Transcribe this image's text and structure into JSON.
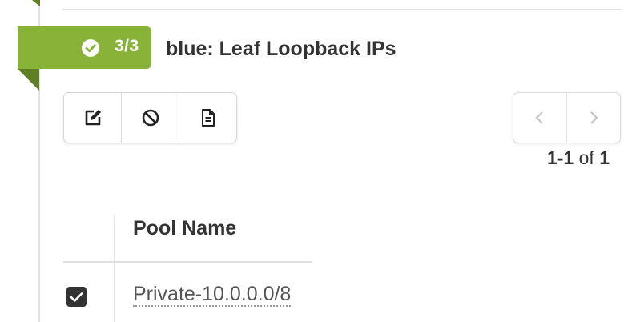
{
  "step": {
    "badge_count": "3/3",
    "title": "blue: Leaf Loopback IPs",
    "badge_color": "#88b338",
    "fold_color": "#5f7f24"
  },
  "toolbar": {
    "buttons": [
      {
        "icon": "edit-icon"
      },
      {
        "icon": "ban-icon"
      },
      {
        "icon": "document-icon"
      }
    ]
  },
  "pagination": {
    "range": "1-1",
    "of_word": "of",
    "total": "1",
    "prev_icon": "chevron-left-icon",
    "next_icon": "chevron-right-icon"
  },
  "table": {
    "columns": [
      "",
      "Pool Name"
    ],
    "rows": [
      {
        "checked": true,
        "pool_name": "Private-10.0.0.0/8"
      }
    ]
  }
}
